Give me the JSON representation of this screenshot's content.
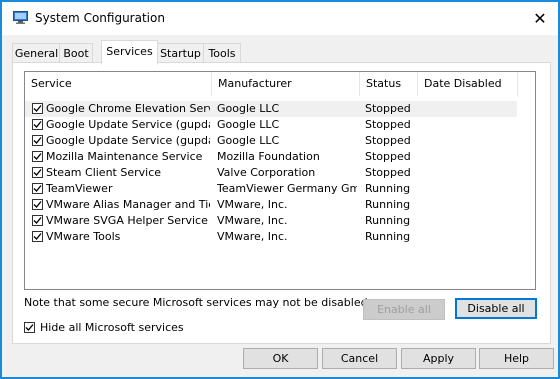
{
  "window": {
    "title": "System Configuration",
    "close_glyph": "✕"
  },
  "tabs": [
    {
      "label": "General"
    },
    {
      "label": "Boot"
    },
    {
      "label": "Services"
    },
    {
      "label": "Startup"
    },
    {
      "label": "Tools"
    }
  ],
  "services_list": {
    "columns": [
      "Service",
      "Manufacturer",
      "Status",
      "Date Disabled"
    ],
    "rows": [
      {
        "service": "Google Chrome Elevation Servic...",
        "manufacturer": "Google LLC",
        "status": "Stopped",
        "date_disabled": "",
        "checked": true
      },
      {
        "service": "Google Update Service (gupdate)",
        "manufacturer": "Google LLC",
        "status": "Stopped",
        "date_disabled": "",
        "checked": true
      },
      {
        "service": "Google Update Service (gupdatem)",
        "manufacturer": "Google LLC",
        "status": "Stopped",
        "date_disabled": "",
        "checked": true
      },
      {
        "service": "Mozilla Maintenance Service",
        "manufacturer": "Mozilla Foundation",
        "status": "Stopped",
        "date_disabled": "",
        "checked": true
      },
      {
        "service": "Steam Client Service",
        "manufacturer": "Valve Corporation",
        "status": "Stopped",
        "date_disabled": "",
        "checked": true
      },
      {
        "service": "TeamViewer",
        "manufacturer": "TeamViewer Germany GmbH",
        "status": "Running",
        "date_disabled": "",
        "checked": true
      },
      {
        "service": "VMware Alias Manager and Ticke...",
        "manufacturer": "VMware, Inc.",
        "status": "Running",
        "date_disabled": "",
        "checked": true
      },
      {
        "service": "VMware SVGA Helper Service",
        "manufacturer": "VMware, Inc.",
        "status": "Running",
        "date_disabled": "",
        "checked": true
      },
      {
        "service": "VMware Tools",
        "manufacturer": "VMware, Inc.",
        "status": "Running",
        "date_disabled": "",
        "checked": true
      }
    ]
  },
  "note": "Note that some secure Microsoft services may not be disabled.",
  "enable_all_label": "Enable all",
  "disable_all_label": "Disable all",
  "hide_ms_label": "Hide all Microsoft services",
  "hide_ms_checked": true,
  "footer": {
    "ok_label": "OK",
    "cancel_label": "Cancel",
    "apply_label": "Apply",
    "help_label": "Help"
  },
  "colors": {
    "accent": "#0078d7",
    "window_border": "#1a8bd9",
    "dialog_bg": "#f0f0f0"
  },
  "icons": {
    "app": "system-configuration-icon",
    "close": "close-icon",
    "check": "checkmark-icon"
  }
}
